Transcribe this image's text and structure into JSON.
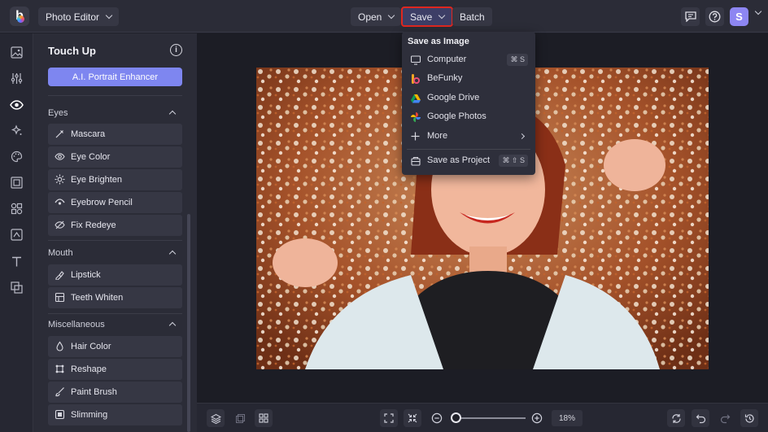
{
  "topbar": {
    "app_menu_label": "Photo Editor",
    "open_label": "Open",
    "save_label": "Save",
    "batch_label": "Batch",
    "avatar_initial": "S"
  },
  "panel": {
    "title": "Touch Up",
    "ai_button": "A.I. Portrait Enhancer",
    "sections": {
      "eyes": {
        "title": "Eyes",
        "tools": [
          "Mascara",
          "Eye Color",
          "Eye Brighten",
          "Eyebrow Pencil",
          "Fix Redeye"
        ]
      },
      "mouth": {
        "title": "Mouth",
        "tools": [
          "Lipstick",
          "Teeth Whiten"
        ]
      },
      "misc": {
        "title": "Miscellaneous",
        "tools": [
          "Hair Color",
          "Reshape",
          "Paint Brush",
          "Slimming"
        ]
      }
    }
  },
  "save_menu": {
    "heading": "Save as Image",
    "items": [
      {
        "label": "Computer",
        "shortcut": "⌘ S",
        "icon": "monitor-icon"
      },
      {
        "label": "BeFunky",
        "icon": "befunky-icon"
      },
      {
        "label": "Google Drive",
        "icon": "google-drive-icon"
      },
      {
        "label": "Google Photos",
        "icon": "google-photos-icon"
      },
      {
        "label": "More",
        "icon": "plus-icon"
      },
      {
        "label": "Save as Project",
        "shortcut": "⌘ ⇧ S",
        "icon": "project-icon"
      }
    ]
  },
  "bottombar": {
    "zoom_value": "18%",
    "zoom_fraction": 0.02
  },
  "colors": {
    "accent": "#7e86f0",
    "highlight_border": "#e0271f",
    "background": "#1f2029",
    "panel": "#2b2c37"
  }
}
